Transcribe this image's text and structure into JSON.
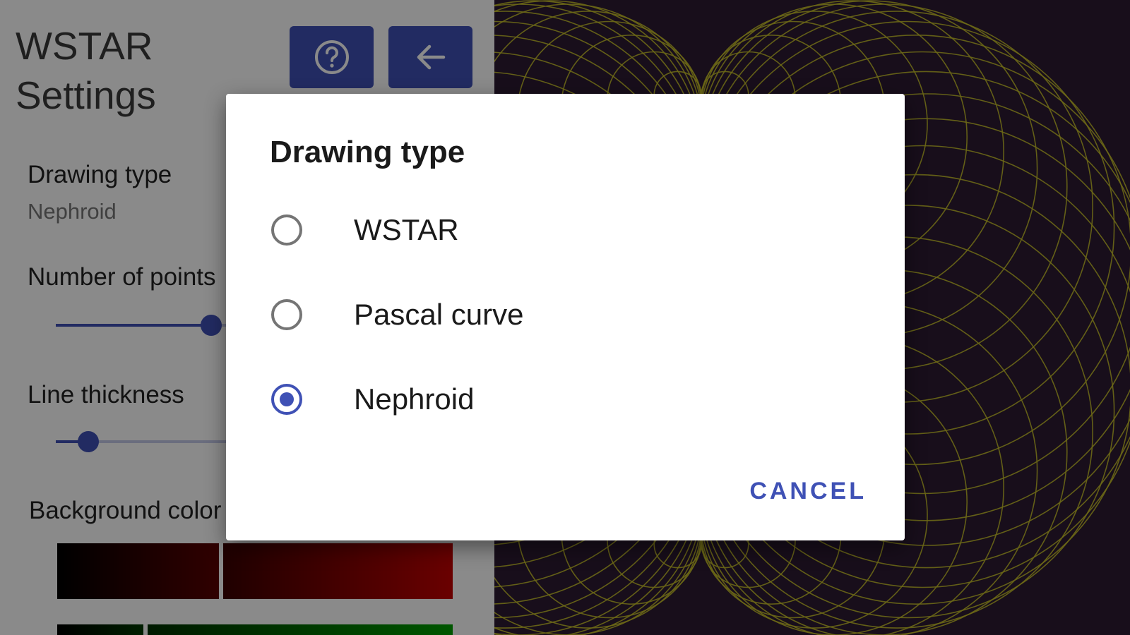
{
  "app": {
    "title_line1": "WSTAR",
    "title_line2": "Settings",
    "help_icon": "help-circle-icon",
    "back_icon": "arrow-left-icon"
  },
  "settings": {
    "drawing_type": {
      "title": "Drawing type",
      "summary": "Nephroid"
    },
    "number_of_points": {
      "title": "Number of points",
      "level": 0.38
    },
    "line_thickness": {
      "title": "Line thickness",
      "level": 0.08
    },
    "background_color": {
      "title": "Background color"
    }
  },
  "dialog": {
    "title": "Drawing type",
    "options": [
      {
        "label": "WSTAR",
        "checked": false
      },
      {
        "label": "Pascal curve",
        "checked": false
      },
      {
        "label": "Nephroid",
        "checked": true
      }
    ],
    "cancel_label": "CANCEL"
  },
  "colors": {
    "accent": "#3f51b5",
    "canvas_bg": "#2d1a33",
    "curve": "#c8c02a"
  }
}
